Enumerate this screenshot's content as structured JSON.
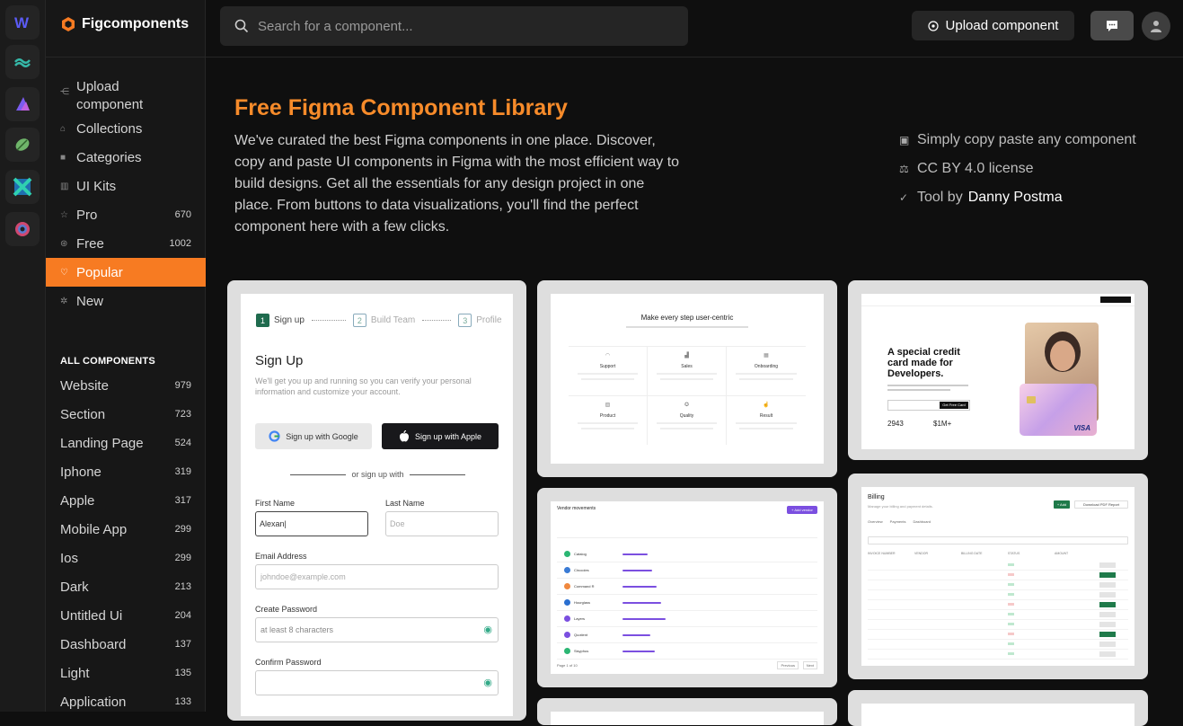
{
  "brand": {
    "name": "Figcomponents"
  },
  "search": {
    "placeholder": "Search for a component..."
  },
  "topbar": {
    "upload_label": "Upload component"
  },
  "nav": [
    {
      "label": "Upload component",
      "icon": "share-icon"
    },
    {
      "label": "Collections",
      "icon": "lock-icon"
    },
    {
      "label": "Categories",
      "icon": "square-icon"
    },
    {
      "label": "UI Kits",
      "icon": "columns-icon"
    },
    {
      "label": "Pro",
      "icon": "star-icon",
      "count": "670"
    },
    {
      "label": "Free",
      "icon": "gift-icon",
      "count": "1002"
    },
    {
      "label": "Popular",
      "icon": "heart-icon"
    },
    {
      "label": "New",
      "icon": "sparkle-icon"
    }
  ],
  "all_components_heading": "ALL COMPONENTS",
  "categories": [
    {
      "label": "Website",
      "count": "979"
    },
    {
      "label": "Section",
      "count": "723"
    },
    {
      "label": "Landing Page",
      "count": "524"
    },
    {
      "label": "Iphone",
      "count": "319"
    },
    {
      "label": "Apple",
      "count": "317"
    },
    {
      "label": "Mobile App",
      "count": "299"
    },
    {
      "label": "Ios",
      "count": "299"
    },
    {
      "label": "Dark",
      "count": "213"
    },
    {
      "label": "Untitled Ui",
      "count": "204"
    },
    {
      "label": "Dashboard",
      "count": "137"
    },
    {
      "label": "Light",
      "count": "135"
    },
    {
      "label": "Application",
      "count": "133"
    }
  ],
  "hero": {
    "title": "Free Figma Component Library",
    "description": "We've curated the best Figma components in one place. Discover, copy and paste UI components in Figma with the most efficient way to build designs. Get all the essentials for any design project in one place. From buttons to data visualizations, you'll find the perfect component here with a few clicks."
  },
  "features": {
    "copy": "Simply copy paste any component",
    "license": "CC BY 4.0 license",
    "tool_prefix": "Tool by",
    "tool_author": "Danny Postma"
  },
  "signup_card": {
    "steps": [
      "Sign up",
      "Build Team",
      "Profile"
    ],
    "step_numbers": [
      "1",
      "2",
      "3"
    ],
    "title": "Sign Up",
    "subtitle": "We'll get you up and running so you can verify your personal information and customize your account.",
    "google_btn": "Sign up with Google",
    "apple_btn": "Sign up with Apple",
    "divider": "or sign up with",
    "first_name_label": "First Name",
    "first_name_value": "Alexan|",
    "last_name_label": "Last Name",
    "last_name_placeholder": "Doe",
    "email_label": "Email Address",
    "email_placeholder": "johndoe@example.com",
    "password_label": "Create Password",
    "password_placeholder": "at least 8 characters",
    "confirm_label": "Confirm Password"
  },
  "features_card": {
    "title": "Make every step user-centric",
    "items": [
      "Support",
      "Sales",
      "Onboarding",
      "Product",
      "Quality",
      "Result"
    ]
  },
  "credit_card": {
    "headline": "A special credit card made for Developers.",
    "cta": "Get Free Card",
    "stat1": "2943",
    "stat2": "$1M+",
    "card_brand": "VISA"
  },
  "vendor_card": {
    "title": "Vendor movements",
    "button": "+ Add vendor",
    "rows": [
      "Catalog",
      "Circooles",
      "Command R",
      "Hourglass",
      "Layers",
      "Quotient",
      "Sisyphus"
    ],
    "footer": "Page 1 of 10",
    "prev": "Previous",
    "next": "Next"
  },
  "billing_card": {
    "title": "Billing",
    "subtitle": "Manage your billing and payment details.",
    "tabs": [
      "Overview",
      "Payments",
      "Dashboard"
    ],
    "add_btn": "+ Add",
    "download_btn": "Download PDF Report",
    "columns": [
      "INVOICE NUMBER",
      "VENDOR",
      "BILLING DATE",
      "STATUS",
      "AMOUNT"
    ]
  },
  "colors": {
    "accent": "#f77b22",
    "background": "#0f0f0f"
  }
}
